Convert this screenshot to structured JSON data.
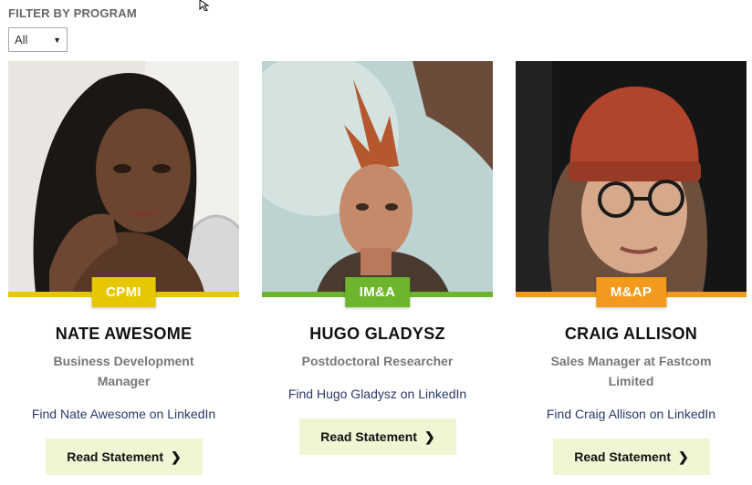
{
  "filter": {
    "label": "FILTER BY PROGRAM",
    "selected": "All"
  },
  "cards": [
    {
      "badge": "CPMI",
      "badge_color": "#e6c800",
      "name": "NATE AWESOME",
      "role": "Business Development Manager",
      "linkedin": "Find Nate Awesome on LinkedIn",
      "button": "Read Statement"
    },
    {
      "badge": "IM&A",
      "badge_color": "#6cb52c",
      "name": "HUGO GLADYSZ",
      "role": "Postdoctoral Researcher",
      "linkedin": "Find Hugo Gladysz on LinkedIn",
      "button": "Read Statement"
    },
    {
      "badge": "M&AP",
      "badge_color": "#f39a1e",
      "name": "CRAIG ALLISON",
      "role": "Sales Manager at Fastcom Limited",
      "linkedin": "Find Craig Allison on LinkedIn",
      "button": "Read Statement"
    }
  ],
  "icons": {
    "cursor": "arrow-cursor-icon",
    "dropdown": "triangle-down-icon",
    "button_chevron": "chevron-right-icon"
  }
}
